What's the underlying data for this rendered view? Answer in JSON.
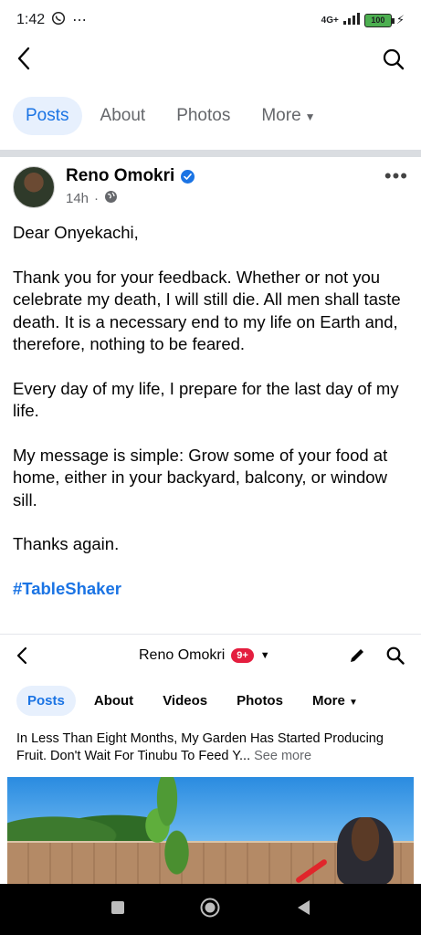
{
  "status_bar": {
    "time": "1:42",
    "network": "4G+",
    "battery": "100"
  },
  "top_nav": {
    "back_icon": "back-arrow-icon",
    "search_icon": "search-icon"
  },
  "tabs": [
    {
      "label": "Posts",
      "active": true
    },
    {
      "label": "About",
      "active": false
    },
    {
      "label": "Photos",
      "active": false
    },
    {
      "label": "More",
      "active": false
    }
  ],
  "post": {
    "author": "Reno Omokri",
    "time": "14h",
    "privacy_icon": "globe-icon",
    "paragraphs": [
      "Dear Onyekachi,",
      "Thank you for your feedback. Whether or not you celebrate my death, I will still die. All men shall taste death. It is a necessary end to my life on Earth and, therefore, nothing to be feared.",
      "Every day of my life, I prepare for the last day of my life.",
      "My message is simple: Grow some of your food at home, either in your backyard, balcony, or window sill.",
      "Thanks again."
    ],
    "hashtag": "#TableShaker"
  },
  "embed": {
    "title": "Reno Omokri",
    "badge": "9+",
    "tabs": [
      {
        "label": "Posts",
        "active": true
      },
      {
        "label": "About",
        "active": false
      },
      {
        "label": "Videos",
        "active": false
      },
      {
        "label": "Photos",
        "active": false
      },
      {
        "label": "More",
        "active": false
      }
    ],
    "caption": "In Less Than Eight Months, My Garden Has Started Producing Fruit. Don't Wait For Tinubu To Feed Y...",
    "see_more": "See more"
  },
  "colors": {
    "accent": "#1b74e4",
    "badge_red": "#e41e3f"
  }
}
